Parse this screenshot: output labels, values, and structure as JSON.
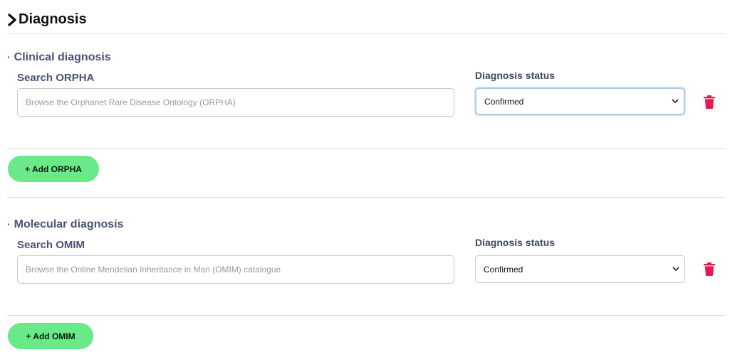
{
  "header": {
    "title": "Diagnosis"
  },
  "sections": [
    {
      "title": "Clinical diagnosis",
      "search_label": "Search ORPHA",
      "search_placeholder": "Browse the Orphanet Rare Disease Ontology (ORPHA)",
      "status_label": "Diagnosis status",
      "status_value": "Confirmed",
      "add_label": "+ Add ORPHA"
    },
    {
      "title": "Molecular diagnosis",
      "search_label": "Search OMIM",
      "search_placeholder": "Browse the Online Mendelian Inheritance in Man (OMIM) catalogue",
      "status_label": "Diagnosis status",
      "status_value": "Confirmed",
      "add_label": "+ Add OMIM"
    }
  ],
  "colors": {
    "accent_button": "#69e987",
    "label": "#4a5275",
    "delete": "#e8174f"
  },
  "icons": {
    "header": "chevron-right-icon",
    "select": "chevron-down-icon",
    "delete": "trash-icon"
  }
}
